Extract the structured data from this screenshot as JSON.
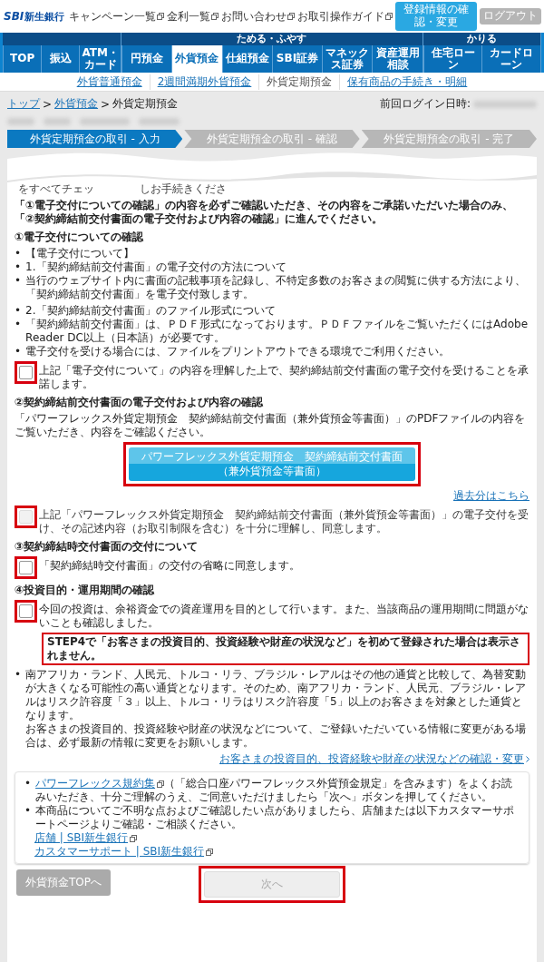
{
  "header": {
    "logo": {
      "mark": "SBI",
      "name": "新生銀行"
    },
    "links": [
      "キャンペーン一覧",
      "金利一覧",
      "お問い合わせ",
      "お取引操作ガイド"
    ],
    "buttons": [
      {
        "label": "登録情報の確認・変更",
        "kind": "primary"
      },
      {
        "label": "ログアウト",
        "kind": "muted"
      }
    ]
  },
  "nav": {
    "groups": [
      {
        "tabs": [
          {
            "label": "TOP",
            "selected": false
          },
          {
            "label": "振込",
            "selected": false
          },
          {
            "label": "ATM・カード",
            "selected": false
          }
        ]
      },
      {
        "label": "ためる・ふやす",
        "tabs": [
          {
            "label": "円預金",
            "selected": false
          },
          {
            "label": "外貨預金",
            "selected": true
          },
          {
            "label": "仕組預金",
            "selected": false
          },
          {
            "label": "SBI証券",
            "selected": false
          },
          {
            "label": "マネックス証券",
            "selected": false
          },
          {
            "label": "資産運用相談",
            "selected": false
          }
        ]
      },
      {
        "label": "かりる",
        "tabs": [
          {
            "label": "住宅ローン",
            "selected": false
          },
          {
            "label": "カードローン",
            "selected": false
          }
        ]
      }
    ],
    "sub_links": [
      {
        "label": "外貨普通預金",
        "selected": false
      },
      {
        "label": "2週間満期外貨預金",
        "selected": false
      },
      {
        "label": "外貨定期預金",
        "selected": true
      },
      {
        "label": "保有商品の手続き・明細",
        "selected": false
      }
    ]
  },
  "breadcrumb": {
    "separator": ">",
    "items": [
      {
        "label": "トップ",
        "link": true
      },
      {
        "label": "外貨預金",
        "link": true
      },
      {
        "label": "外貨定期預金",
        "link": false
      }
    ]
  },
  "last_login_label": "前回ログイン日時:",
  "steps": [
    {
      "label": "外貨定期預金の取引 - 入力",
      "selected": true
    },
    {
      "label": "外貨定期預金の取引 - 確認",
      "selected": false
    },
    {
      "label": "外貨定期預金の取引 - 完了",
      "selected": false
    }
  ],
  "intro_fragments": [
    "をすべてチェッ",
    "しお手続きくださ"
  ],
  "notice": "「①電子交付についての確認」の内容を必ずご確認いただき、その内容をご承諾いただいた場合のみ、「②契約締結前交付書面の電子交付および内容の確認」に進んでください。",
  "sections": [
    {
      "heading": "①電子交付についての確認",
      "items": [
        {
          "kind": "bullets",
          "marker": "•",
          "lines": [
            "【電子交付について】",
            "1.「契約締結前交付書面」の電子交付の方法について",
            "当行のウェブサイト内に書面の記載事項を記録し、不特定多数のお客さまの閲覧に供する方法により、「契約締結前交付書面」を電子交付致します。"
          ]
        },
        {
          "kind": "bullets",
          "marker": "•",
          "lines": [
            "2.「契約締結前交付書面」のファイル形式について",
            "「契約締結前交付書面」は、ＰＤＦ形式になっております。ＰＤＦファイルをご覧いただくにはAdobe Reader DC以上（日本語）が必要です。",
            "電子交付を受ける場合には、ファイルをプリントアウトできる環境でご利用ください。"
          ]
        },
        {
          "kind": "checkbox",
          "text": "上記「電子交付について」の内容を理解した上で、契約締結前交付書面の電子交付を受けることを承諾します。",
          "checked": false,
          "disabled": false,
          "highlighted": true
        }
      ]
    },
    {
      "heading": "②契約締結前交付書面の電子交付および内容の確認",
      "items": [
        {
          "kind": "paragraph",
          "text": "「パワーフレックス外貨定期預金　契約締結前交付書面（兼外貨預金等書面）」のPDFファイルの内容をご覧いただき、内容をご確認ください。"
        },
        {
          "kind": "pdf_button",
          "lines": [
            "パワーフレックス外貨定期預金　契約締結前交付書面",
            "（兼外貨預金等書面）"
          ],
          "highlighted": true
        },
        {
          "kind": "link",
          "text": "過去分はこちら",
          "chevron": false
        },
        {
          "kind": "checkbox",
          "text": "上記「パワーフレックス外貨定期預金　契約締結前交付書面（兼外貨預金等書面）」の電子交付を受け、その記述内容（お取引制限を含む）を十分に理解し、同意します。",
          "checked": false,
          "disabled": true,
          "highlighted": true
        }
      ]
    },
    {
      "heading": "③契約締結時交付書面の交付について",
      "items": [
        {
          "kind": "checkbox",
          "text": "「契約締結時交付書面」の交付の省略に同意します。",
          "checked": false,
          "disabled": false,
          "highlighted": true
        }
      ]
    },
    {
      "heading": "④投資目的・運用期間の確認",
      "items": [
        {
          "kind": "checkbox",
          "text": "今回の投資は、余裕資金での資産運用を目的として行います。また、当該商品の運用期間に問題がないことも確認しました。",
          "checked": false,
          "disabled": false,
          "highlighted": true
        },
        {
          "kind": "callout",
          "text": "STEP4で「お客さまの投資目的、投資経験や財産の状況など」を初めて登録された場合は表示されません。"
        },
        {
          "kind": "note",
          "marker": "•",
          "lines": [
            "南アフリカ・ランド、人民元、トルコ・リラ、ブラジル・レアルはその他の通貨と比較して、為替変動が大きくなる可能性の高い通貨となります。そのため、南アフリカ・ランド、人民元、ブラジル・レアルはリスク許容度「３」以上、トルコ・リラはリスク許容度「5」以上のお客さまを対象とした通貨となります。",
            "お客さまの投資目的、投資経験や財産の状況などについて、ご登録いただいている情報に変更がある場合は、必ず最新の情報に変更をお願いします。"
          ]
        },
        {
          "kind": "link",
          "text": "お客さまの投資目的、投資経験や財産の状況などの確認・変更",
          "chevron": true
        }
      ]
    }
  ],
  "info_box": [
    {
      "marker": "•",
      "link": "パワーフレックス規約集",
      "text": "（「総合口座パワーフレックス外貨預金規定」を含みます）をよくお読みいただき、十分ご理解のうえ、ご同意いただけましたら「次へ」ボタンを押してください。"
    },
    {
      "marker": "•",
      "text": "本商品についてご不明な点およびご確認したい点がありましたら、店舗または以下カスタマーサポートページよりご確認・ご相談ください。",
      "sub_links": [
        "店舗 | SBI新生銀行",
        "カスタマーサポート | SBI新生銀行"
      ]
    }
  ],
  "footer": {
    "back_button": "外貨預金TOPへ",
    "next_button": {
      "label": "次へ",
      "disabled": true,
      "highlighted": true
    }
  }
}
